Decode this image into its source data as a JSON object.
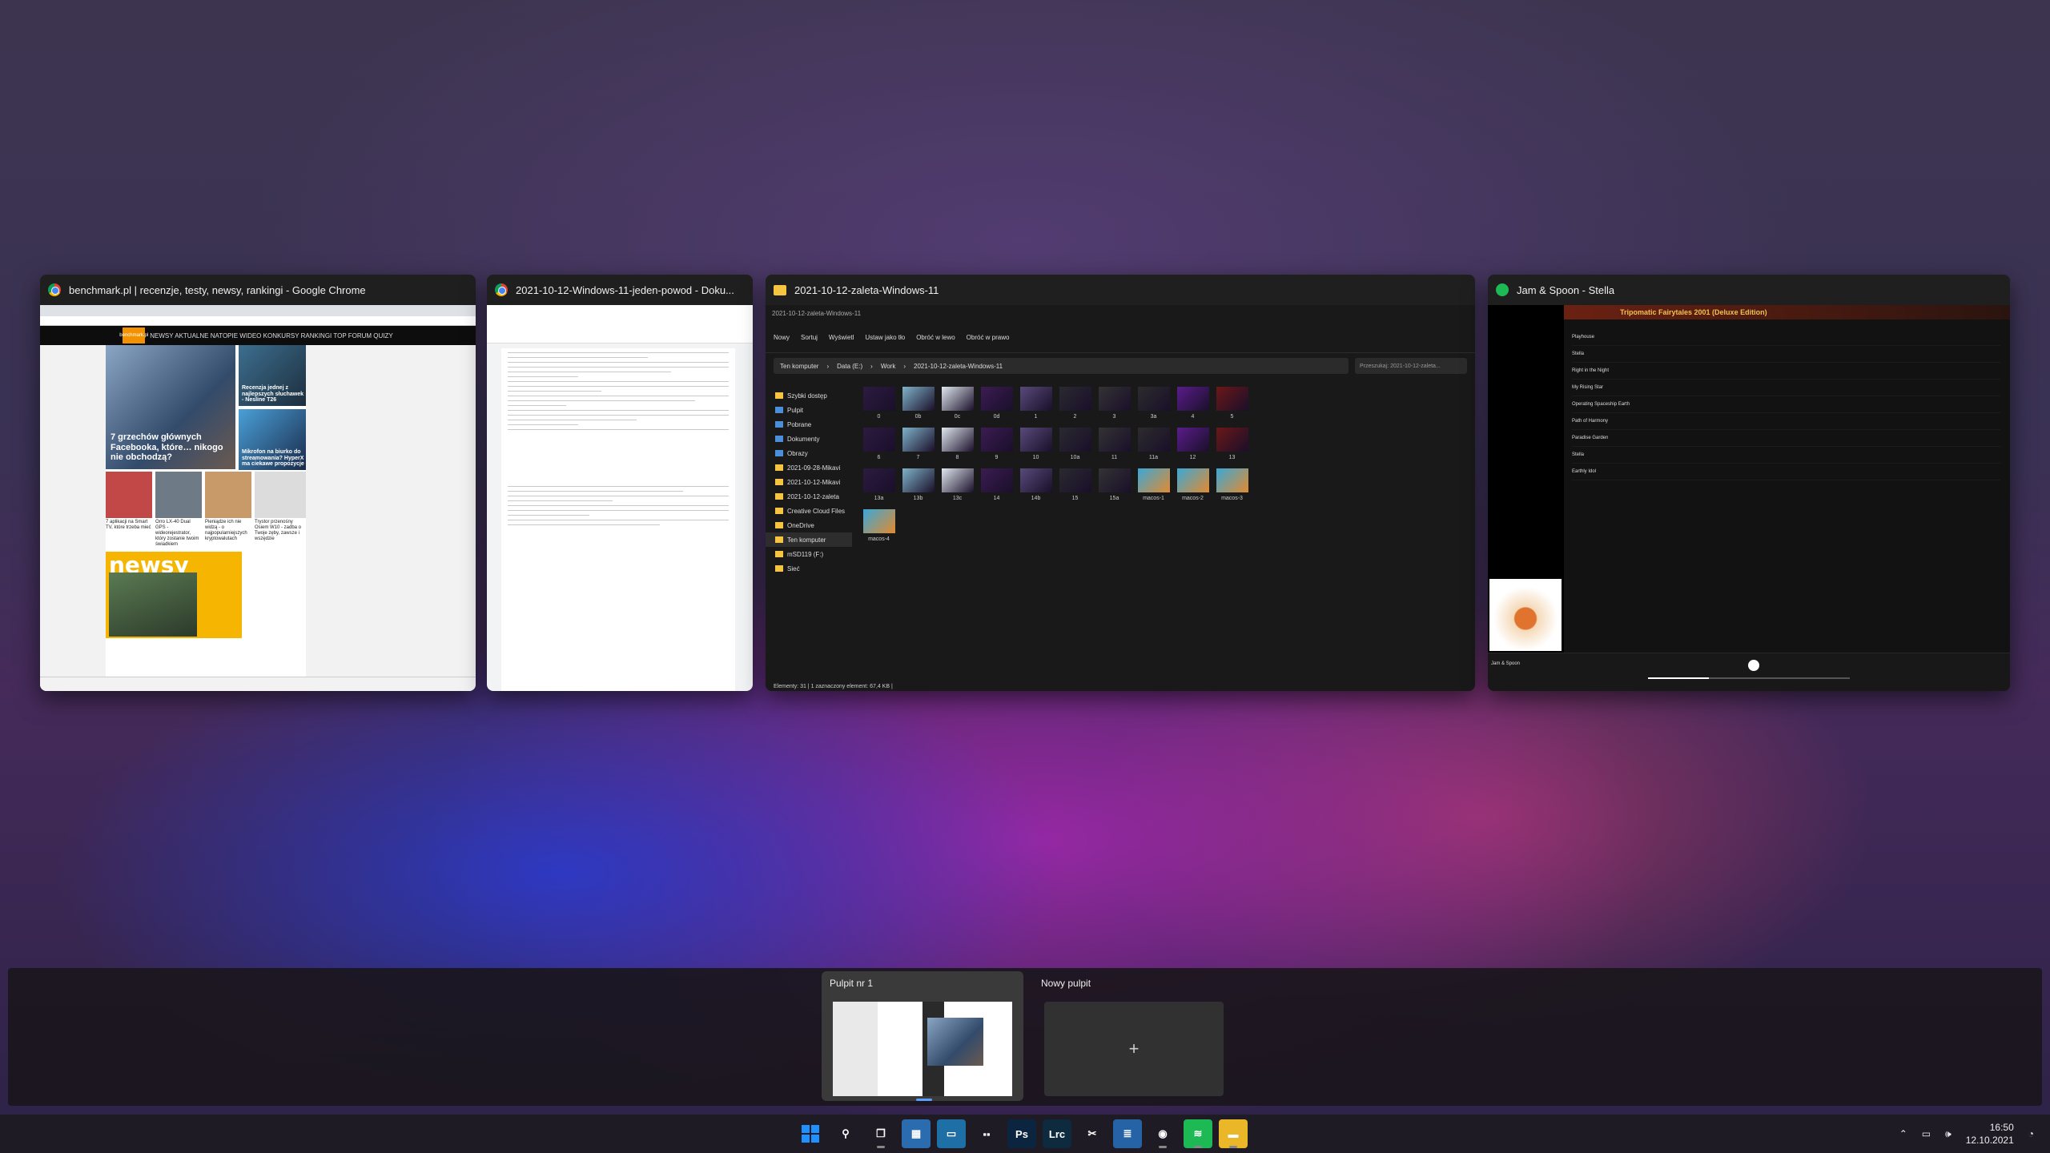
{
  "windows": [
    {
      "title": "benchmark.pl | recenzje, testy, newsy, rankingi - Google Chrome",
      "icon": "chrome-icon",
      "content": {
        "nav": "NEWSY  AKTUALNE  NATOPIE  WIDEO  KONKURSY  RANKINGI  TOP  FORUM  QUIZY",
        "logo": "benchmark.pl",
        "hero": "7 grzechów głównych Facebooka, które… nikogo nie obchodzą?",
        "side1": "Recenzja jednej z najlepszych słuchawek - Nesline T26",
        "side2": "Mikrofon na biurko do streamowania? HyperX ma ciekawe propozycje",
        "captions": [
          "7 aplikacji na Smart TV, które trzeba mieć",
          "Orro LX-40 Dual GPS - wideorejestrator, który zostanie twoim świadkiem",
          "Pieniądze ich nie widzą - o najpopularniejszych kryptowalutach",
          "Trystor przenośny Osiem W10 - zadba o Twoje zęby, zawsze i wszędzie"
        ],
        "newsy": "newsy"
      }
    },
    {
      "title": "2021-10-12-Windows-11-jeden-powod - Doku...",
      "icon": "chrome-icon"
    },
    {
      "title": "2021-10-12-zaleta-Windows-11",
      "icon": "folder-icon",
      "content": {
        "toolbar": [
          "Nowy",
          "Sortuj",
          "Wyświetl",
          "Ustaw jako tło",
          "Obróć w lewo",
          "Obróć w prawo"
        ],
        "path": [
          "Ten komputer",
          "Data (E:)",
          "Work",
          "2021-10-12-zaleta-Windows-11"
        ],
        "search": "Przeszukaj: 2021-10-12-zaleta...",
        "nav": [
          "Szybki dostęp",
          "Pulpit",
          "Pobrane",
          "Dokumenty",
          "Obrazy",
          "2021-09-28-Mikavi",
          "2021-10-12-Mikavi",
          "2021-10-12-zaleta",
          "Creative Cloud Files",
          "OneDrive",
          "Ten komputer",
          "mSD119 (F:)",
          "Sieć"
        ],
        "files": [
          "0",
          "0b",
          "0c",
          "0d",
          "1",
          "2",
          "3",
          "3a",
          "4",
          "5",
          "6",
          "7",
          "8",
          "9",
          "10",
          "10a",
          "11",
          "11a",
          "12",
          "13",
          "13a",
          "13b",
          "13c",
          "14",
          "14b",
          "15",
          "15a",
          "macos-1",
          "macos-2",
          "macos-3",
          "macos-4"
        ],
        "status": "Elementy: 31  |  1 zaznaczony element: 67,4 KB  |"
      }
    },
    {
      "title": "Jam & Spoon - Stella",
      "icon": "spotify-icon",
      "content": {
        "album": "Tripomatic Fairytales 2001 (Deluxe Edition)",
        "tracks": [
          "Playhouse",
          "Stella",
          "Right in the Night",
          "My Rising Star",
          "Operating Spaceship Earth",
          "Path of Harmony",
          "Paradise Garden",
          "Stella",
          "Earthly Idol"
        ],
        "now_playing": "Jam & Spoon"
      }
    }
  ],
  "desktops": [
    {
      "label": "Pulpit nr 1"
    },
    {
      "label": "Nowy pulpit",
      "plus": "+"
    }
  ],
  "taskbar": {
    "icons": [
      {
        "name": "start-icon",
        "label": "",
        "color": "#1e90ff"
      },
      {
        "name": "search-icon",
        "label": "⚲",
        "color": "transparent"
      },
      {
        "name": "task-view-icon",
        "label": "❐",
        "color": "transparent"
      },
      {
        "name": "widgets-icon",
        "label": "▦",
        "color": "#2b6cb0"
      },
      {
        "name": "teams-icon",
        "label": "▭",
        "color": "#1e6fa5"
      },
      {
        "name": "taskbar-app-icon",
        "label": "▪▪",
        "color": "transparent"
      },
      {
        "name": "photoshop-icon",
        "label": "Ps",
        "color": "#0b2440"
      },
      {
        "name": "lightroom-icon",
        "label": "Lrc",
        "color": "#0d2a3f"
      },
      {
        "name": "snipping-tool-icon",
        "label": "✂",
        "color": "transparent"
      },
      {
        "name": "notepad-icon",
        "label": "≣",
        "color": "#2563a6"
      },
      {
        "name": "chrome-icon",
        "label": "◉",
        "color": "transparent"
      },
      {
        "name": "spotify-icon",
        "label": "≋",
        "color": "#1db954"
      },
      {
        "name": "file-explorer-icon",
        "label": "▬",
        "color": "#e9b728"
      }
    ],
    "time": "16:50",
    "date": "12.10.2021"
  }
}
